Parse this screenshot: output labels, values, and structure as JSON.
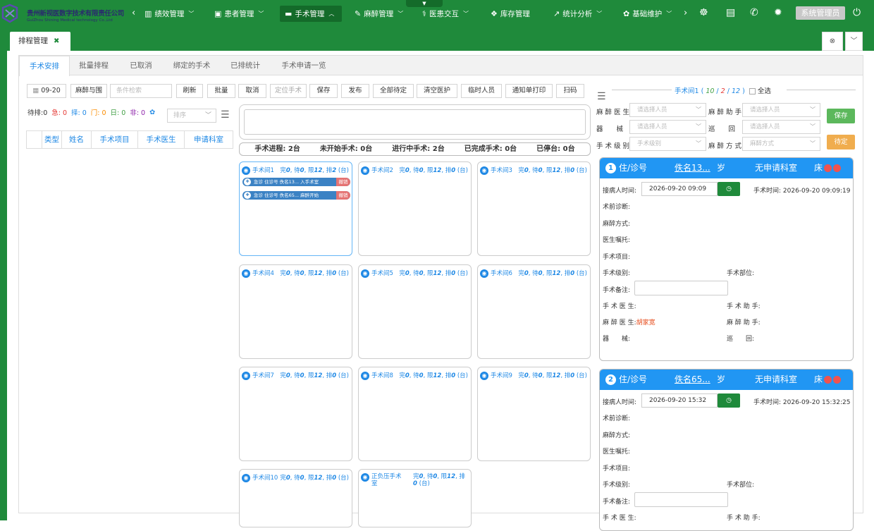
{
  "header": {
    "company_line1": "贵州新视医数字技术有限责任公司",
    "company_line2": "GuiZhou Shining Medical technology Co.,Ltd",
    "nav": [
      "绩效管理",
      "患者管理",
      "手术管理",
      "麻醉管理",
      "医患交互",
      "库存管理",
      "统计分析",
      "基础维护"
    ],
    "admin": "系统管理员"
  },
  "page_tab": {
    "label": "排程管理"
  },
  "subtabs": [
    "手术安排",
    "批量排程",
    "已取消",
    "绑定的手术",
    "已排统计",
    "手术申请一览"
  ],
  "toolbar": {
    "date": "09-20",
    "anes_btn": "麻醉与围",
    "search_placeholder": "条件检索",
    "buttons": [
      "刷新",
      "批量",
      "取消",
      "定位手术",
      "保存",
      "发布",
      "全部待定",
      "清空医护",
      "临时人员",
      "通知单打印",
      "扫码"
    ]
  },
  "stats": {
    "waiting": "待排:0",
    "urgent": "急: 0",
    "elective": "择: 0",
    "outpatient": "门: 0",
    "day": "日: 0",
    "non": "非: 0",
    "sort_placeholder": "排序"
  },
  "left_columns": [
    "类型",
    "姓名",
    "手术项目",
    "手术医生",
    "申请科室"
  ],
  "progress": {
    "a": "手术进程: 2台",
    "b": "未开始手术: 0台",
    "c": "进行中手术: 2台",
    "d": "已完成手术: 0台",
    "e": "已停台: 0台"
  },
  "rooms": [
    {
      "name": "手术间1",
      "done": "0",
      "wait": "0",
      "limit": "12",
      "sched": "2"
    },
    {
      "name": "手术间2",
      "done": "0",
      "wait": "0",
      "limit": "12",
      "sched": "0"
    },
    {
      "name": "手术间3",
      "done": "0",
      "wait": "0",
      "limit": "12",
      "sched": "0"
    },
    {
      "name": "手术间4",
      "done": "0",
      "wait": "0",
      "limit": "12",
      "sched": "0"
    },
    {
      "name": "手术间5",
      "done": "0",
      "wait": "0",
      "limit": "12",
      "sched": "0"
    },
    {
      "name": "手术间6",
      "done": "0",
      "wait": "0",
      "limit": "12",
      "sched": "0"
    },
    {
      "name": "手术间7",
      "done": "0",
      "wait": "0",
      "limit": "12",
      "sched": "0"
    },
    {
      "name": "手术间8",
      "done": "0",
      "wait": "0",
      "limit": "12",
      "sched": "0"
    },
    {
      "name": "手术间9",
      "done": "0",
      "wait": "0",
      "limit": "12",
      "sched": "0"
    },
    {
      "name": "手术间10",
      "done": "0",
      "wait": "0",
      "limit": "12",
      "sched": "0"
    },
    {
      "name": "正负压手术室",
      "done": "0",
      "wait": "0",
      "limit": "12",
      "sched": "0"
    }
  ],
  "room1_pills": [
    {
      "text": "急诊  住诊号  佚名13... 入手术室",
      "del": "撤销"
    },
    {
      "text": "急诊  住诊号  佚名65... 麻醉开始",
      "del": "撤销"
    }
  ],
  "right": {
    "title_pre": "手术间1 (",
    "c1": "10",
    "c2": "2",
    "c3": "12",
    "title_post": ")",
    "select_all": "全选",
    "labels": {
      "anes_doc": "麻 醉 医 生",
      "anes_asst": "麻 醉 助 手",
      "instrument": "器　　械",
      "circulate": "巡　　回",
      "level": "手 术 级 别",
      "method": "麻 醉 方 式"
    },
    "select_ph": "请选择人员",
    "level_ph": "手术级别",
    "method_ph": "麻醉方式",
    "save": "保存",
    "pending": "待定"
  },
  "cards": [
    {
      "num": "1",
      "inout": "住/诊号",
      "name": "佚名13...",
      "age": "岁",
      "dept": "无申请科室",
      "bed": "床",
      "recv_label": "接病人时间:",
      "recv": "2026-09-20 09:09",
      "op_time": "手术时间: 2026-09-20 09:09:19",
      "anes_doc": "胡家宽"
    },
    {
      "num": "2",
      "inout": "住/诊号",
      "name": "佚名65...",
      "age": "岁",
      "dept": "无申请科室",
      "bed": "床",
      "recv_label": "接病人时间:",
      "recv": "2026-09-20 15:32",
      "op_time": "手术时间: 2026-09-20 15:32:25",
      "anes_doc": ""
    }
  ],
  "card_fields": {
    "pre_diag": "术前诊断:",
    "anes_method": "麻醉方式:",
    "order": "医生嘱托:",
    "item": "手术项目:",
    "level": "手术级别:",
    "site": "手术部位:",
    "memo": "手术备注:",
    "surgeon": "手 术 医 生:",
    "asst": "手 术 助 手:",
    "anes_doc": "麻 醉 医 生:",
    "anes_asst": "麻 醉 助 手:",
    "instr": "器　　械:",
    "circ": "巡　　回:"
  }
}
